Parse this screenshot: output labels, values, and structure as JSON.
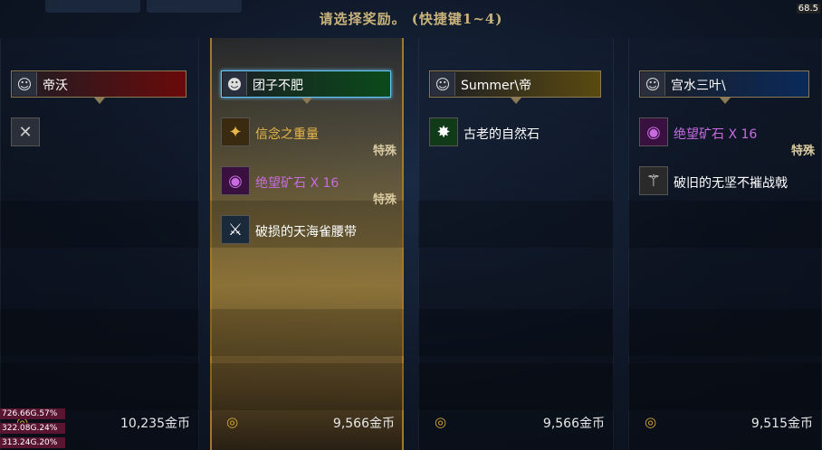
{
  "title": "请选择奖励。 (快捷键1~4)",
  "corner_label": "68.5",
  "special_label": "特殊",
  "stats": [
    "726.66G.57%",
    "322.08G.24%",
    "313.24G.20%"
  ],
  "columns": [
    {
      "player": "帝沃",
      "header_color": "#6a0a0a",
      "selected": false,
      "items": [
        {
          "name": "",
          "icon": "x-icon",
          "color": "#cccccc",
          "special": false
        }
      ],
      "gold": "10,235金币"
    },
    {
      "player": "团子不肥",
      "header_color": "#0a4a1a",
      "selected": true,
      "items": [
        {
          "name": "信念之重量",
          "icon": "weight-icon",
          "color": "#e9b84a",
          "special": true
        },
        {
          "name": "绝望矿石 X 16",
          "icon": "ore-icon",
          "color": "#c86ce0",
          "special": true
        },
        {
          "name": "破损的天海雀腰带",
          "icon": "belt-icon",
          "color": "#ffffff",
          "special": false
        }
      ],
      "gold": "9,566金币"
    },
    {
      "player": "Summer\\帝",
      "header_color": "#5a4a10",
      "selected": false,
      "items": [
        {
          "name": "古老的自然石",
          "icon": "nature-stone-icon",
          "color": "#ffffff",
          "special": false
        }
      ],
      "gold": "9,566金币"
    },
    {
      "player": "宫水三叶\\",
      "header_color": "#0a2a5a",
      "selected": false,
      "items": [
        {
          "name": "绝望矿石 X 16",
          "icon": "ore-icon",
          "color": "#c86ce0",
          "special": true
        },
        {
          "name": "破旧的无坚不摧战戟",
          "icon": "halberd-icon",
          "color": "#ffffff",
          "special": false
        }
      ],
      "gold": "9,515金币"
    }
  ]
}
